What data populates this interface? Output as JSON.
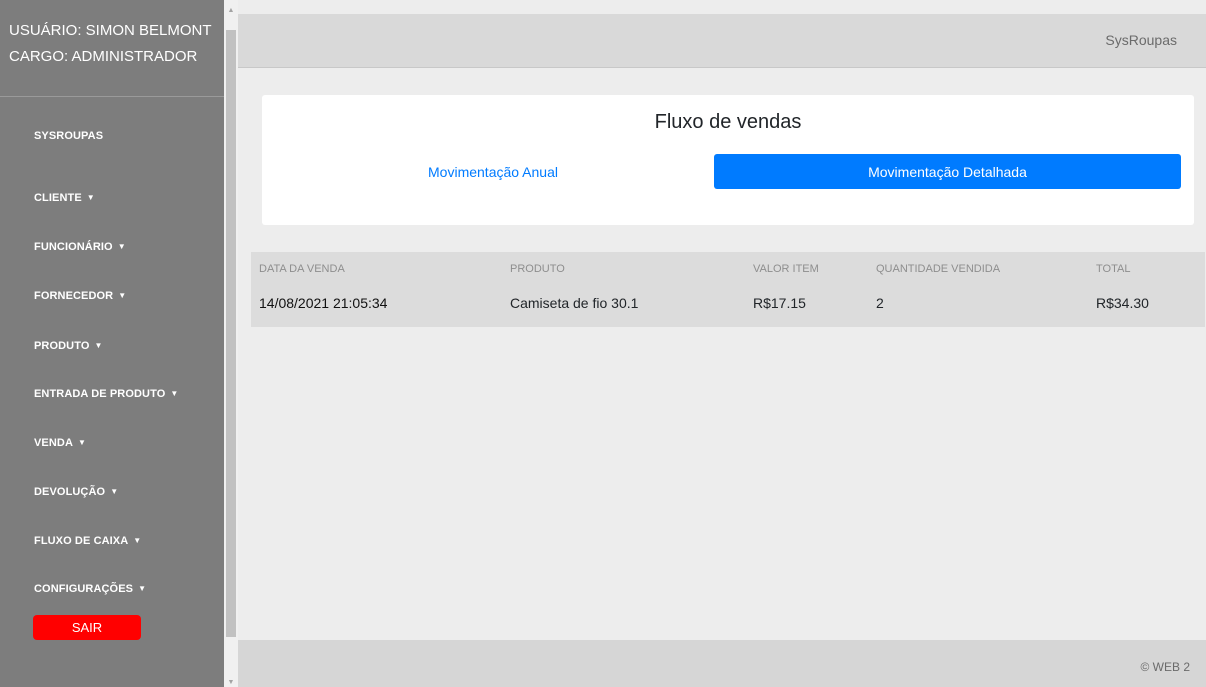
{
  "sidebar": {
    "user_line": "USUÁRIO: SIMON BELMONT",
    "role_line": "CARGO: ADMINISTRADOR",
    "items": [
      {
        "label": "SYSROUPAS",
        "has_caret": false
      },
      {
        "label": "CLIENTE",
        "has_caret": true
      },
      {
        "label": "FUNCIONÁRIO",
        "has_caret": true
      },
      {
        "label": "FORNECEDOR",
        "has_caret": true
      },
      {
        "label": "PRODUTO",
        "has_caret": true
      },
      {
        "label": "ENTRADA DE PRODUTO",
        "has_caret": true
      },
      {
        "label": "VENDA",
        "has_caret": true
      },
      {
        "label": "DEVOLUÇÃO",
        "has_caret": true
      },
      {
        "label": "FLUXO DE CAIXA",
        "has_caret": true
      },
      {
        "label": "CONFIGURAÇÕES",
        "has_caret": true
      }
    ],
    "logout_label": "SAIR",
    "logout_color": "#ff0000"
  },
  "header": {
    "brand": "SysRoupas"
  },
  "card": {
    "title": "Fluxo de vendas",
    "tabs": [
      {
        "label": "Movimentação Anual",
        "active": false
      },
      {
        "label": "Movimentação Detalhada",
        "active": true
      }
    ],
    "accent_color": "#007bff"
  },
  "table": {
    "columns": [
      "DATA DA VENDA",
      "PRODUTO",
      "VALOR ITEM",
      "QUANTIDADE VENDIDA",
      "TOTAL"
    ],
    "rows": [
      [
        "14/08/2021 21:05:34",
        "Camiseta de fio 30.1",
        "R$17.15",
        "2",
        "R$34.30"
      ]
    ]
  },
  "footer": {
    "text": "© WEB 2"
  },
  "icons": {
    "caret": "caret-down-icon",
    "scroll_up": "scroll-up-arrow-icon",
    "scroll_down": "scroll-down-arrow-icon"
  }
}
